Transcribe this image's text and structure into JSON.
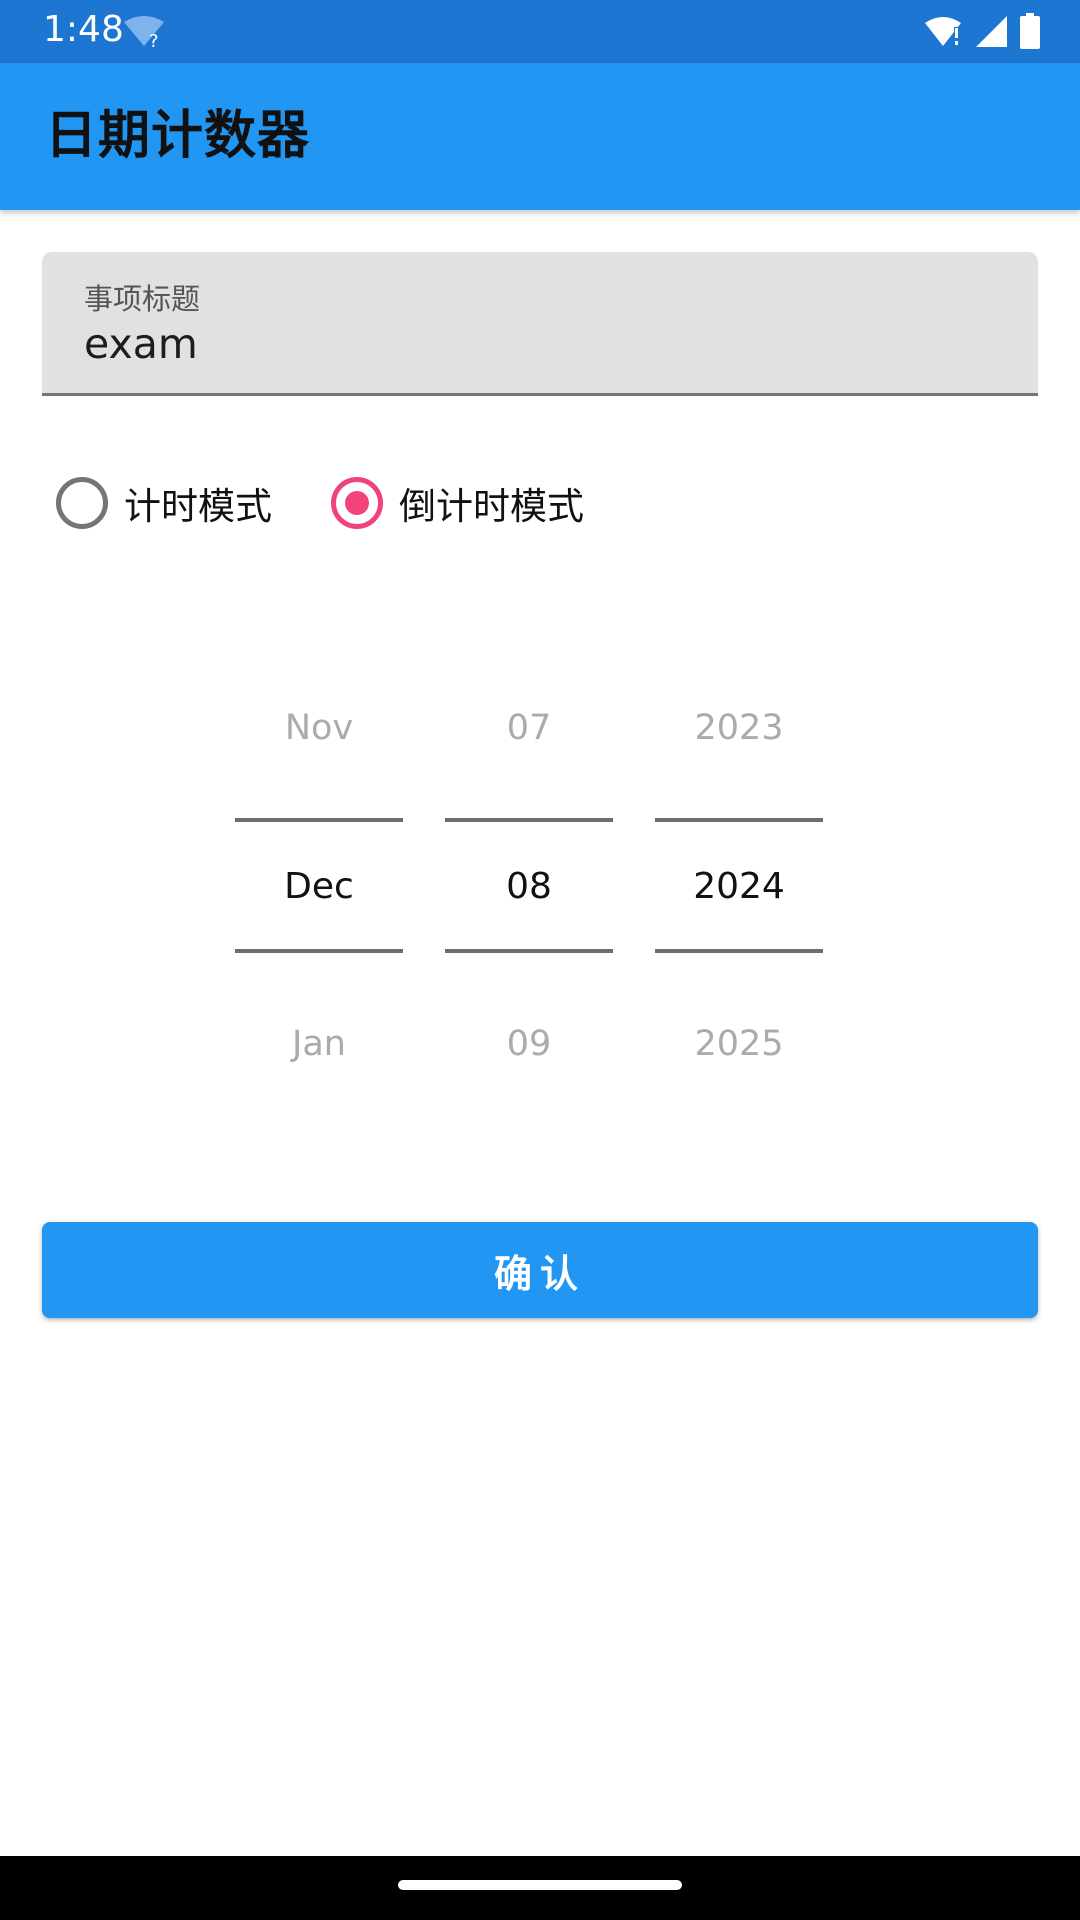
{
  "status_bar": {
    "time": "1:48",
    "icons": [
      "wifi-question-icon",
      "wifi-alert-icon",
      "signal-icon",
      "battery-icon"
    ]
  },
  "app_bar": {
    "title": "日期计数器"
  },
  "title_field": {
    "label": "事项标题",
    "value": "exam"
  },
  "mode": {
    "options": [
      {
        "label": "计时模式",
        "selected": false
      },
      {
        "label": "倒计时模式",
        "selected": true
      }
    ]
  },
  "date_picker": {
    "month": {
      "prev": "Nov",
      "selected": "Dec",
      "next": "Jan"
    },
    "day": {
      "prev": "07",
      "selected": "08",
      "next": "09"
    },
    "year": {
      "prev": "2023",
      "selected": "2024",
      "next": "2025"
    }
  },
  "confirm_button": {
    "label": "确认"
  },
  "colors": {
    "status_bar": "#1C76D2",
    "app_bar": "#2196F3",
    "accent_radio": "#F0437A",
    "button": "#2196F3",
    "field_background": "#E1E1E1"
  }
}
